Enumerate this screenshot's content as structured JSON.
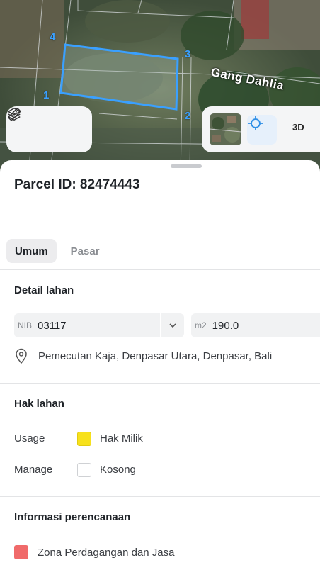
{
  "map": {
    "street_name": "Gang Dahlia",
    "corner_labels": [
      "1",
      "2",
      "3",
      "4"
    ],
    "parcel_outline_color": "#3aa0ff",
    "controls": {
      "layers_icon": "layers-icon",
      "measure_icon": "ruler-icon",
      "basemap_icon": "satellite-thumbnail",
      "locate_icon": "crosshair-icon",
      "three_d_label": "3D"
    }
  },
  "parcel": {
    "title": "Parcel ID: 82474443"
  },
  "tabs": [
    {
      "label": "Umum",
      "active": true
    },
    {
      "label": "Pasar",
      "active": false
    }
  ],
  "detail": {
    "section_title": "Detail lahan",
    "nib_prefix": "NIB",
    "nib_value": "03117",
    "area_prefix": "m2",
    "area_value": "190.0",
    "location": "Pemecutan Kaja, Denpasar Utara, Denpasar, Bali"
  },
  "rights": {
    "section_title": "Hak lahan",
    "usage_label": "Usage",
    "usage_value": "Hak Milik",
    "usage_color": "#f7e11c",
    "manage_label": "Manage",
    "manage_value": "Kosong",
    "manage_color": "#ffffff"
  },
  "planning": {
    "section_title": "Informasi perencanaan",
    "zone": "Zona Perdagangan dan Jasa",
    "zone_color": "#f06a6a"
  }
}
